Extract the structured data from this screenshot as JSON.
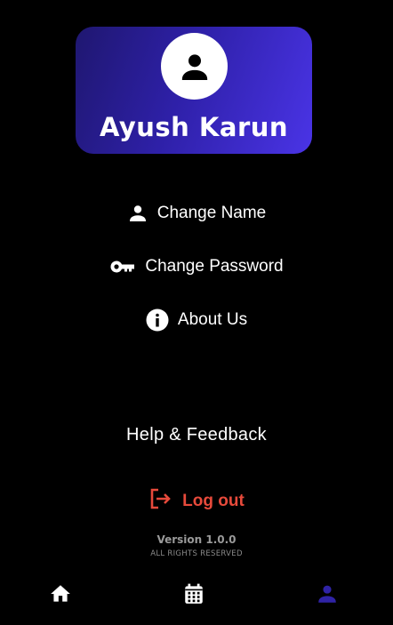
{
  "profile": {
    "name": "Ayush Karun",
    "avatar_icon": "person-icon"
  },
  "menu": {
    "items": [
      {
        "label": "Change Name",
        "icon": "person-icon"
      },
      {
        "label": "Change Password",
        "icon": "key-icon"
      },
      {
        "label": "About Us",
        "icon": "info-icon"
      }
    ]
  },
  "help": {
    "label": "Help & Feedback"
  },
  "logout": {
    "label": "Log out",
    "icon": "logout-icon",
    "color": "#e74a3b"
  },
  "footer": {
    "version": "Version 1.0.0",
    "rights": "ALL RIGHTS RESERVED"
  },
  "bottom_nav": {
    "items": [
      {
        "icon": "home-icon",
        "active": false
      },
      {
        "icon": "calendar-icon",
        "active": false
      },
      {
        "icon": "profile-icon",
        "active": true
      }
    ],
    "active_color": "#2f23a6",
    "inactive_color": "#ffffff"
  },
  "theme": {
    "background": "#000000",
    "card_gradient_start": "#1f1770",
    "card_gradient_end": "#4a34e6"
  }
}
